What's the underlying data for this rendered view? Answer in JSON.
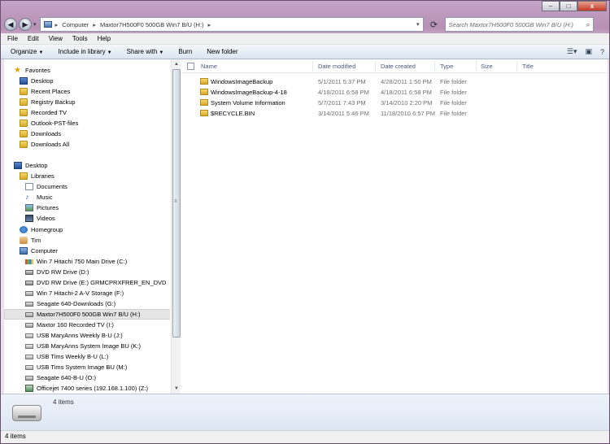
{
  "window": {
    "controls": {
      "minimize": "–",
      "maximize": "□",
      "close": "x"
    }
  },
  "address": {
    "crumbs": [
      "Computer",
      "Maxtor7H500F0 500GB  Win7  B/U (H:)"
    ],
    "search_placeholder": "Search Maxtor7H500F0 500GB  Win7  B/U (H:)"
  },
  "menu": [
    "File",
    "Edit",
    "View",
    "Tools",
    "Help"
  ],
  "toolbar": {
    "organize": "Organize",
    "include": "Include in library",
    "share": "Share with",
    "burn": "Burn",
    "new_folder": "New folder"
  },
  "nav": {
    "favorites": "Favorites",
    "fav_items": [
      "Desktop",
      "Recent Places",
      "Registry Backup",
      "Recorded TV",
      "Outlook-PST-files",
      "Downloads",
      "Downloads All"
    ],
    "desktop": "Desktop",
    "libraries": "Libraries",
    "lib_items": [
      "Documents",
      "Music",
      "Pictures",
      "Videos"
    ],
    "homegroup": "Homegroup",
    "user": "Tim",
    "computer": "Computer",
    "drives": [
      "Win 7 Hitachi 750 Main Drive (C:)",
      "DVD RW Drive (D:)",
      "DVD RW Drive (E:) GRMCPRXFRER_EN_DVD",
      "Win 7 Hitachi-2 A-V Storage (F:)",
      "Seagate 640-Downloads (G:)",
      "Maxtor7H500F0 500GB  Win7  B/U (H:)",
      "Maxtor  160 Recorded TV (I:)",
      "USB MaryAnns Weekly B-U (J:)",
      "USB MaryAnns System Image BU (K:)",
      "USB Tims Weekly B-U (L:)",
      "USB Tims System Image BU (M:)",
      "Seagate 640-B-U (O:)",
      "Officejet 7400 series (192.168.1.100) (Z:)"
    ]
  },
  "columns": {
    "name": "Name",
    "modified": "Date modified",
    "created": "Date created",
    "type": "Type",
    "size": "Size",
    "title": "Title"
  },
  "files": [
    {
      "name": "WindowsImageBackup",
      "modified": "5/1/2011 5:37 PM",
      "created": "4/28/2011 1:50 PM",
      "type": "File folder"
    },
    {
      "name": "WindowsImageBackup-4-18",
      "modified": "4/18/2011 6:58 PM",
      "created": "4/18/2011 6:58 PM",
      "type": "File folder"
    },
    {
      "name": "System Volume Information",
      "modified": "5/7/2011 7:43 PM",
      "created": "3/14/2010 2:20 PM",
      "type": "File folder"
    },
    {
      "name": "$RECYCLE.BIN",
      "modified": "3/14/2011 5:46 PM",
      "created": "11/18/2010 6:57 PM",
      "type": "File folder"
    }
  ],
  "details": {
    "count": "4 items"
  },
  "status": {
    "text": "4 items"
  }
}
